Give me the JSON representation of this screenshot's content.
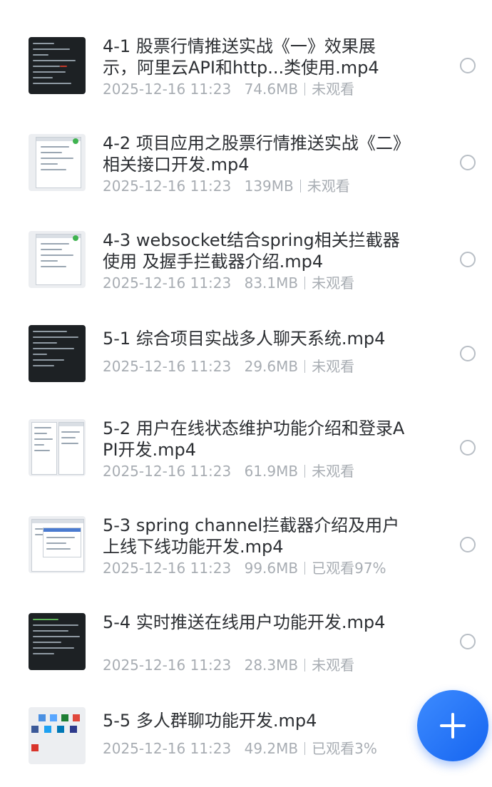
{
  "files": [
    {
      "title": "4-1 股票行情推送实战《一》效果展示，阿里云API和http...类使用.mp4",
      "date": "2025-12-16 11:23",
      "size": "74.6MB",
      "status": "未观看",
      "thumbnail": "dark-terminal-thumbnail"
    },
    {
      "title": "4-2 项目应用之股票行情推送实战《二》相关接口开发.mp4",
      "date": "2025-12-16 11:23",
      "size": "139MB",
      "status": "未观看",
      "thumbnail": "dialog-window-thumbnail"
    },
    {
      "title": "4-3 websocket结合spring相关拦截器使用 及握手拦截器介绍.mp4",
      "date": "2025-12-16 11:23",
      "size": "83.1MB",
      "status": "未观看",
      "thumbnail": "dialog-window-thumbnail"
    },
    {
      "title": "5-1 综合项目实战多人聊天系统.mp4",
      "date": "2025-12-16 11:23",
      "size": "29.6MB",
      "status": "未观看",
      "thumbnail": "dark-terminal-thumbnail"
    },
    {
      "title": "5-2 用户在线状态维护功能介绍和登录API开发.mp4",
      "date": "2025-12-16 11:23",
      "size": "61.9MB",
      "status": "未观看",
      "thumbnail": "ide-window-thumbnail"
    },
    {
      "title": "5-3 spring channel拦截器介绍及用户上线下线功能开发.mp4",
      "date": "2025-12-16 11:23",
      "size": "99.6MB",
      "status": "已观看97%",
      "thumbnail": "ide-window-thumbnail"
    },
    {
      "title": "5-4 实时推送在线用户功能开发.mp4",
      "date": "2025-12-16 11:23",
      "size": "28.3MB",
      "status": "未观看",
      "thumbnail": "dark-terminal-thumbnail"
    },
    {
      "title": "5-5 多人群聊功能开发.mp4",
      "date": "2025-12-16 11:23",
      "size": "49.2MB",
      "status": "已观看3%",
      "thumbnail": "browser-desktop-thumbnail"
    }
  ],
  "fab": {
    "icon": "plus-icon",
    "color": "#1f6ff5"
  },
  "colors": {
    "title": "#2c2f33",
    "meta": "#a8adb3",
    "radio": "#b8bec5",
    "accent": "#1f6ff5"
  }
}
